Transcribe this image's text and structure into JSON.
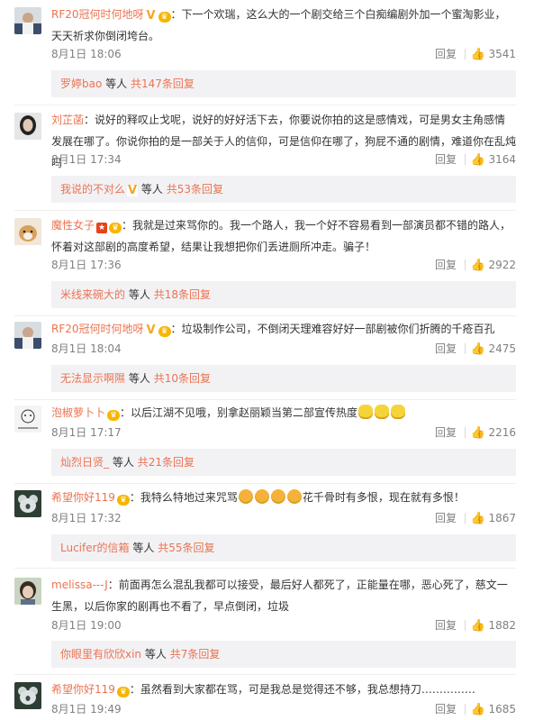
{
  "comments": [
    {
      "user": "RF20冠何时何地呀",
      "text": "：下一个欢瑞，这么大的一个剧交给三个白痴编剧外加一个蜜淘影业，天天祈求你倒闭垮台。",
      "time": "8月1日 18:06",
      "reply_label": "回复",
      "likes": "3541",
      "sub": {
        "user": "罗婷bao",
        "mid": "等人",
        "link": "共147条回复"
      }
    },
    {
      "user": "刘芷菡",
      "text": "：说好的释叹止戈呢，说好的好好活下去，你要说你拍的这是感情戏，可是男女主角感情发展在哪了。你说你拍的是一部关于人的信仰，可是信仰在哪了，狗屁不通的剧情，难道你在乱炖吗",
      "time": "8月1日 17:34",
      "reply_label": "回复",
      "likes": "3164",
      "sub": {
        "user": "我说的不对么",
        "mid": "等人",
        "link": "共53条回复"
      }
    },
    {
      "user": "魔性女子",
      "text": "：我就是过来骂你的。我一个路人，我一个好不容易看到一部演员都不错的路人，怀着对这部剧的高度希望，结果让我想把你们丢进厕所冲走。骗子！",
      "time": "8月1日 17:36",
      "reply_label": "回复",
      "likes": "2922",
      "sub": {
        "user": "米线来碗大的",
        "mid": "等人",
        "link": "共18条回复"
      }
    },
    {
      "user": "RF20冠何时何地呀",
      "text": "：垃圾制作公司，不倒闭天理难容好好一部剧被你们折腾的千疮百孔",
      "time": "8月1日 18:04",
      "reply_label": "回复",
      "likes": "2475",
      "sub": {
        "user": "无法显示啊隰",
        "mid": "等人",
        "link": "共10条回复"
      }
    },
    {
      "user": "泡椒萝卜卜",
      "text": "：以后江湖不见哦，别拿赵丽颖当第二部宣传热度",
      "time": "8月1日 17:17",
      "reply_label": "回复",
      "likes": "2216",
      "sub": {
        "user": "灿烈日贤_",
        "mid": "等人",
        "link": "共21条回复"
      }
    },
    {
      "user": "希望你好119",
      "text_a": "：我特么特地过来咒骂",
      "text_b": "花千骨时有多恨，现在就有多恨！",
      "time": "8月1日 17:32",
      "reply_label": "回复",
      "likes": "1867",
      "sub": {
        "user": "Lucifer的信箱",
        "mid": "等人",
        "link": "共55条回复"
      }
    },
    {
      "user": "melissa---J",
      "text": "：前面再怎么混乱我都可以接受，最后好人都死了，正能量在哪，恶心死了，慈文一生黑，以后你家的剧再也不看了，早点倒闭，垃圾",
      "time": "8月1日 19:00",
      "reply_label": "回复",
      "likes": "1882",
      "sub": {
        "user": "你眼里有欣欣xin",
        "mid": "等人",
        "link": "共7条回复"
      }
    },
    {
      "user": "希望你好119",
      "text": "：虽然看到大家都在骂，可是我总是觉得还不够，我总想持刀……………",
      "time": "8月1日 19:49",
      "reply_label": "回复",
      "likes": "1685"
    }
  ]
}
